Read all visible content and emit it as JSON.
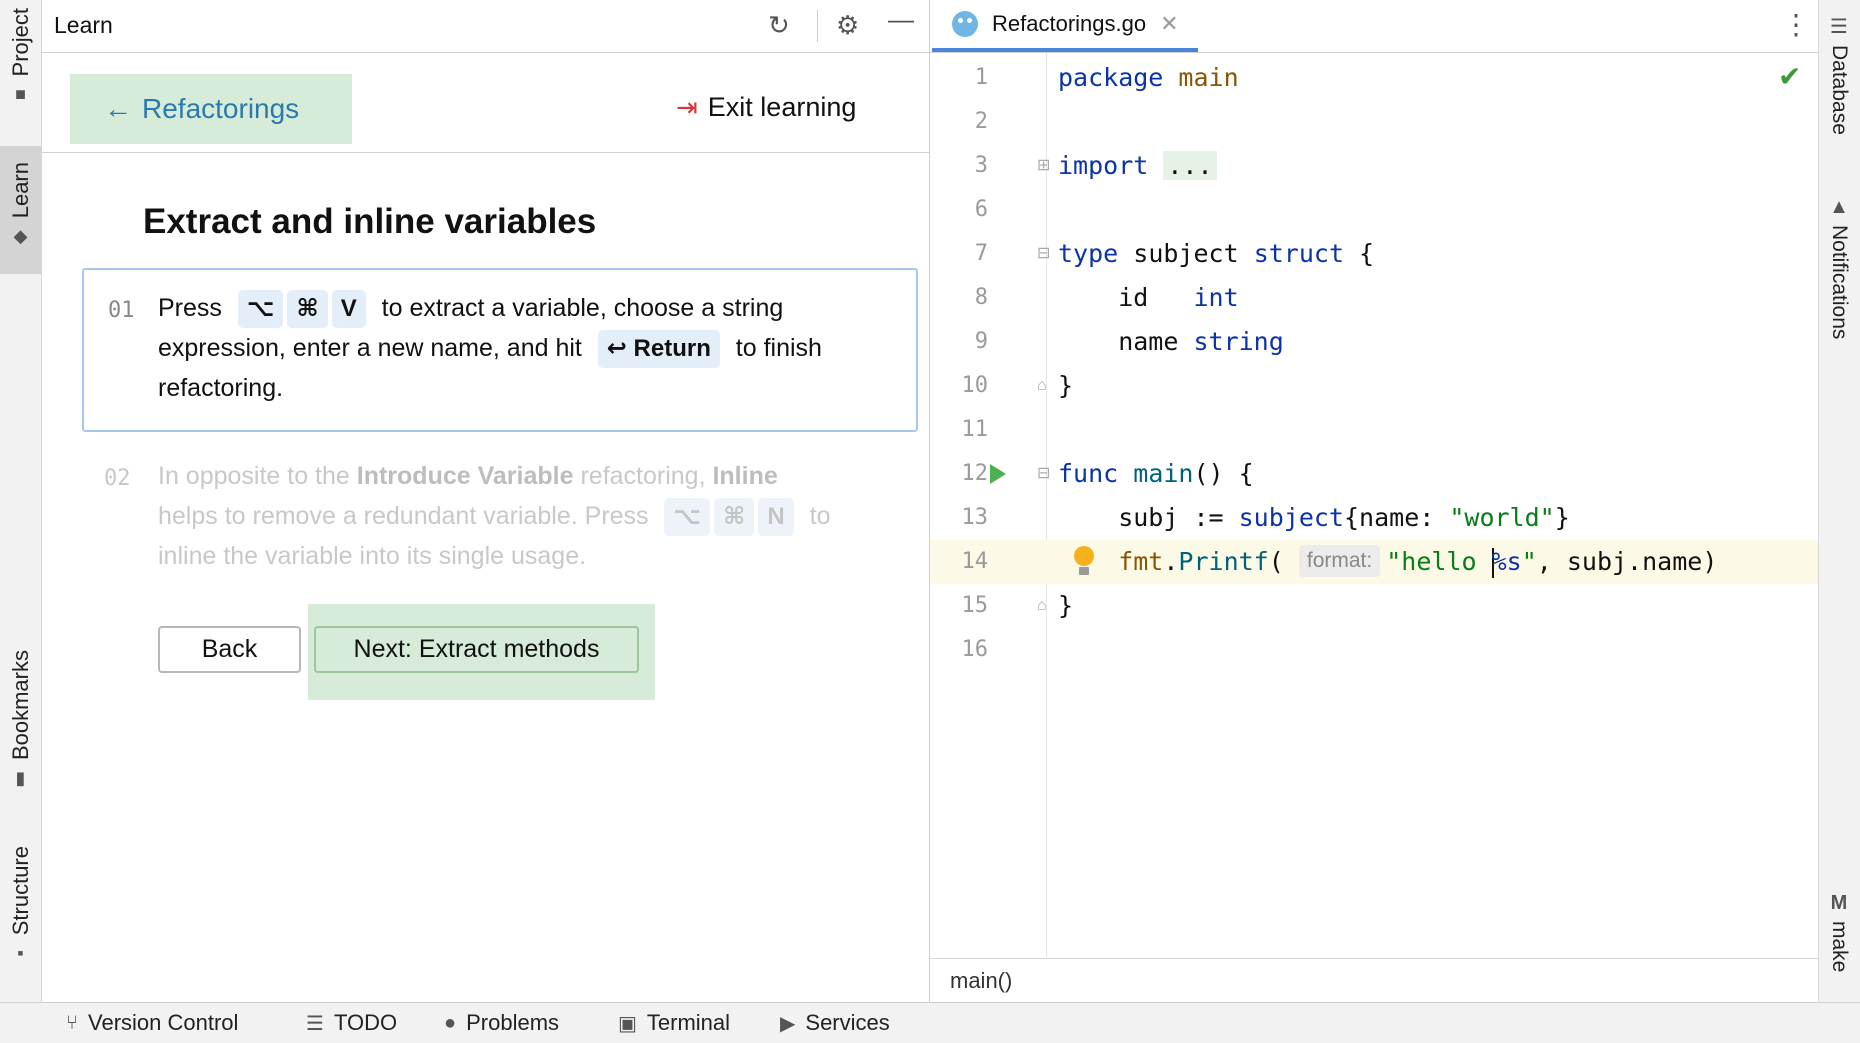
{
  "left_stripe": {
    "tabs": [
      {
        "label": "Project",
        "icon": "folder-icon"
      },
      {
        "label": "Learn",
        "icon": "graduation-cap-icon"
      },
      {
        "label": "Bookmarks",
        "icon": "bookmark-icon"
      },
      {
        "label": "Structure",
        "icon": "structure-icon"
      }
    ]
  },
  "right_stripe": {
    "tabs": [
      {
        "label": "Database",
        "icon": "database-icon"
      },
      {
        "label": "Notifications",
        "icon": "bell-icon"
      },
      {
        "label": "make",
        "icon": "make-icon"
      }
    ]
  },
  "learn": {
    "title": "Learn",
    "back_label": "Refactorings",
    "exit_label": "Exit learning",
    "lesson_title": "Extract and inline variables",
    "step1": {
      "num": "01",
      "press": "Press",
      "keys": [
        "⌥",
        "⌘",
        "V"
      ],
      "text_a": "to extract a variable, choose a string",
      "text_b": "expression, enter a new name, and hit",
      "return_key": "↩ Return",
      "text_c": "to finish",
      "text_d": "refactoring."
    },
    "step2": {
      "num": "02",
      "text_a": "In opposite to the ",
      "bold_a": "Introduce Variable",
      "text_b": " refactoring, ",
      "bold_b": "Inline",
      "text_c": "helps to remove a redundant variable. Press",
      "keys": [
        "⌥",
        "⌘",
        "N"
      ],
      "text_d": "to",
      "text_e": "inline the variable into its single usage."
    },
    "back_button": "Back",
    "next_button": "Next: Extract methods"
  },
  "editor": {
    "tab_label": "Refactorings.go",
    "breadcrumb": "main()",
    "lines": [
      "1",
      "2",
      "3",
      "6",
      "7",
      "8",
      "9",
      "10",
      "11",
      "12",
      "13",
      "14",
      "15",
      "16"
    ],
    "code": {
      "l1_kw": "package",
      "l1_name": "main",
      "l3_kw": "import",
      "l3_fold": "...",
      "l7_kw": "type",
      "l7_name": " subject ",
      "l7_kw2": "struct",
      "l7_brace": " {",
      "l8_field": "    id   ",
      "l8_type": "int",
      "l9_field": "    name ",
      "l9_type": "string",
      "l10": "}",
      "l12_kw": "func",
      "l12_name": "main",
      "l12_rest": "() {",
      "l13_a": "    subj := ",
      "l13_type": "subject",
      "l13_b": "{name: ",
      "l13_str": "\"world\"",
      "l13_c": "}",
      "l14_pkg": "    fmt",
      "l14_dot": ".",
      "l14_fn": "Printf",
      "l14_paren": "(",
      "l14_hint": "format:",
      "l14_str_a": "\"hello ",
      "l14_str_fmt": "%s",
      "l14_str_b": "\"",
      "l14_rest": ", subj.name)",
      "l15": "}"
    }
  },
  "bottom_bar": {
    "items": [
      {
        "label": "Version Control",
        "icon": "branch-icon"
      },
      {
        "label": "TODO",
        "icon": "list-icon"
      },
      {
        "label": "Problems",
        "icon": "warning-icon"
      },
      {
        "label": "Terminal",
        "icon": "terminal-icon"
      },
      {
        "label": "Services",
        "icon": "services-icon"
      }
    ]
  },
  "colors": {
    "accent_green_bg": "#d6ecd8",
    "link_blue": "#2a7ab0",
    "keyword": "#0b33a8",
    "string": "#067d17",
    "tab_underline": "#4a86d8"
  }
}
